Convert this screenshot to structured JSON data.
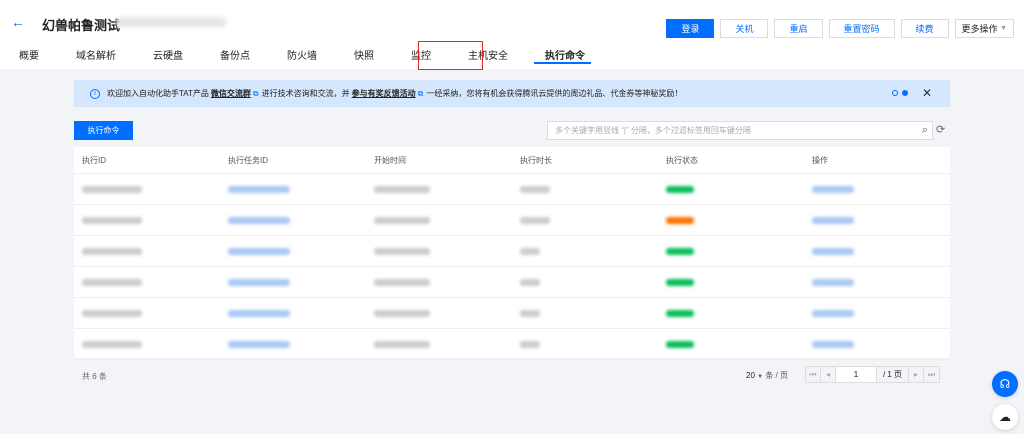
{
  "header": {
    "title": "幻兽帕鲁测试",
    "back_icon": "arrow-left-icon"
  },
  "actions": {
    "login": "登录",
    "shutdown": "关机",
    "restart": "重启",
    "reset_password": "重置密码",
    "renew": "续费",
    "more": "更多操作"
  },
  "tabs": [
    "概要",
    "域名解析",
    "云硬盘",
    "备份点",
    "防火墙",
    "快照",
    "监控",
    "主机安全",
    "执行命令"
  ],
  "active_tab": "执行命令",
  "banner": {
    "text1": "欢迎加入自动化助手TAT产品",
    "link1": "微信交流群",
    "text2": "进行技术咨询和交流，并",
    "link2": "参与有奖反馈活动",
    "text3": "一经采纳，您将有机会获得腾讯云提供的周边礼品、代金券等神秘奖励！"
  },
  "toolbar": {
    "run_command": "执行命令",
    "search_placeholder": "多个关键字用竖线 “|” 分隔，多个过滤标签用回车键分隔"
  },
  "table": {
    "columns": [
      "执行ID",
      "执行任务ID",
      "开始时间",
      "执行时长",
      "执行状态",
      "操作"
    ],
    "status_colors": [
      "#0abf5b",
      "#ff7200",
      "#0abf5b",
      "#0abf5b",
      "#0abf5b",
      "#0abf5b"
    ]
  },
  "footer": {
    "total": "共 6 条",
    "page_size": "20",
    "per_page": "条 / 页",
    "page": "1",
    "total_pages": "/ 1 页"
  },
  "colors": {
    "primary": "#006eff",
    "highlight": "#e0262e"
  }
}
